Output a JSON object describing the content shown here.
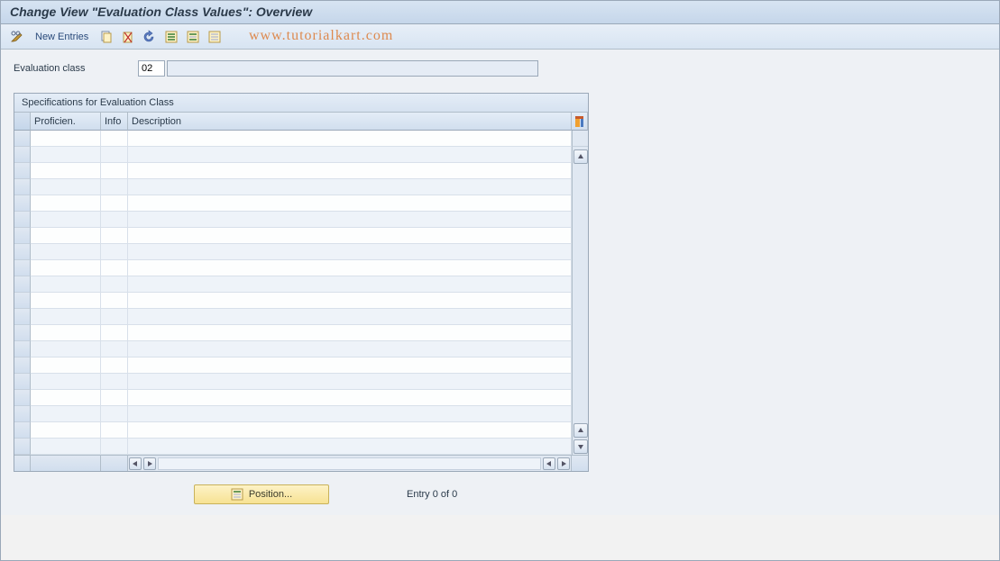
{
  "title": "Change View \"Evaluation Class Values\": Overview",
  "toolbar": {
    "new_entries_label": "New Entries"
  },
  "watermark": "www.tutorialkart.com",
  "field": {
    "label": "Evaluation class",
    "code": "02",
    "desc": ""
  },
  "panel": {
    "title": "Specifications for Evaluation Class",
    "columns": {
      "proficiency": "Proficien.",
      "info": "Info",
      "description": "Description"
    },
    "rows": []
  },
  "footer": {
    "position_label": "Position...",
    "entry_text": "Entry 0 of 0"
  }
}
